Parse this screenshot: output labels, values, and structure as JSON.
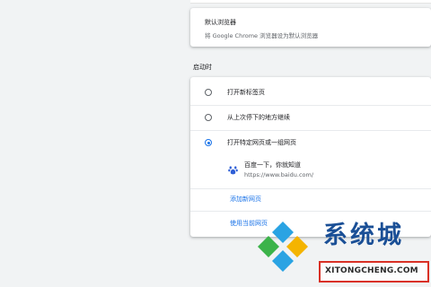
{
  "default_browser": {
    "title": "默认浏览器",
    "subtitle": "将 Google Chrome 浏览器设为默认浏览器"
  },
  "startup": {
    "section_title": "启动时",
    "options": [
      {
        "label": "打开新标签页",
        "selected": false
      },
      {
        "label": "从上次停下的地方继续",
        "selected": false
      },
      {
        "label": "打开特定网页或一组网页",
        "selected": true
      }
    ],
    "page": {
      "title": "百度一下，你就知道",
      "url": "https://www.baidu.com/",
      "icon": "baidu-paw-icon"
    },
    "add_page_link": "添加新网页",
    "use_current_link": "使用当前网页"
  },
  "watermark": {
    "brand": "系统城",
    "url": "XITONGCHENG.COM",
    "colors": {
      "blue": "#1a4f96",
      "box": "#d93025"
    }
  },
  "colors": {
    "accent": "#1a73e8",
    "background": "#f1f3f4"
  }
}
